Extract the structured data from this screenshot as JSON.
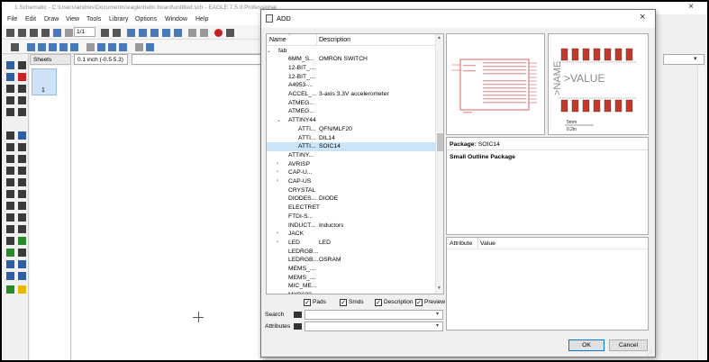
{
  "main_window": {
    "title": "1 Schematic - C:\\Users\\andres\\Documents\\eagle\\hello board\\untitled.sch - EAGLE 7.5.0 Professional",
    "menu": [
      "File",
      "Edit",
      "Draw",
      "View",
      "Tools",
      "Library",
      "Options",
      "Window",
      "Help"
    ],
    "zoom_select": "1/1",
    "sheets_label": "Sheets",
    "sheet_number": "1",
    "coordinate_readout": "0.1 inch (-0.5 5.3)",
    "close_icon": "×"
  },
  "dialog": {
    "title": "ADD",
    "close_icon": "×",
    "list": {
      "col_name": "Name",
      "col_description": "Description",
      "rows": [
        {
          "exp": "⌄",
          "name": "fab",
          "desc": "",
          "level": 0
        },
        {
          "exp": "",
          "name": "6MM_S...",
          "desc": "OMRON SWITCH",
          "level": 1
        },
        {
          "exp": "",
          "name": "12-BIT_...",
          "desc": "",
          "level": 1
        },
        {
          "exp": "",
          "name": "12-BIT_...",
          "desc": "",
          "level": 1
        },
        {
          "exp": "",
          "name": "A4953-...",
          "desc": "",
          "level": 1
        },
        {
          "exp": "",
          "name": "ACCEL_...",
          "desc": "3-axis 3.3V accelerometer",
          "level": 1
        },
        {
          "exp": "",
          "name": "ATMEG...",
          "desc": "",
          "level": 1
        },
        {
          "exp": "",
          "name": "ATMEG...",
          "desc": "",
          "level": 1
        },
        {
          "exp": "⌄",
          "name": "ATTINY44",
          "desc": "",
          "level": 1
        },
        {
          "exp": "",
          "name": "ATTI...",
          "desc": "QFN/MLF20",
          "level": 2
        },
        {
          "exp": "",
          "name": "ATTI...",
          "desc": "DIL14",
          "level": 2
        },
        {
          "exp": "",
          "name": "ATTI...",
          "desc": "SOIC14",
          "level": 2,
          "selected": true
        },
        {
          "exp": "",
          "name": "ATTINY...",
          "desc": "",
          "level": 1
        },
        {
          "exp": "›",
          "name": "AVRISP",
          "desc": "",
          "level": 1
        },
        {
          "exp": "›",
          "name": "CAP-U...",
          "desc": "",
          "level": 1
        },
        {
          "exp": "›",
          "name": "CAP-US",
          "desc": "",
          "level": 1
        },
        {
          "exp": "",
          "name": "CRYSTAL",
          "desc": "",
          "level": 1
        },
        {
          "exp": "",
          "name": "DIODES...",
          "desc": "DIODE",
          "level": 1
        },
        {
          "exp": "",
          "name": "ELECTRET",
          "desc": "",
          "level": 1
        },
        {
          "exp": "",
          "name": "FTDI-S...",
          "desc": "",
          "level": 1
        },
        {
          "exp": "",
          "name": "INDUCT...",
          "desc": "Inductors",
          "level": 1
        },
        {
          "exp": "›",
          "name": "JACK",
          "desc": "",
          "level": 1
        },
        {
          "exp": "›",
          "name": "LED",
          "desc": "LED",
          "level": 1
        },
        {
          "exp": "",
          "name": "LEDRGB...",
          "desc": "",
          "level": 1
        },
        {
          "exp": "",
          "name": "LEDRGB...",
          "desc": "OSRAM",
          "level": 1
        },
        {
          "exp": "",
          "name": "MEMS_...",
          "desc": "",
          "level": 1
        },
        {
          "exp": "",
          "name": "MEMS_...",
          "desc": "",
          "level": 1
        },
        {
          "exp": "",
          "name": "MIC_ME...",
          "desc": "",
          "level": 1
        },
        {
          "exp": "",
          "name": "MXD623...",
          "desc": "",
          "level": 1
        }
      ]
    },
    "checks": [
      {
        "label": "Pads",
        "checked": true
      },
      {
        "label": "Smds",
        "checked": true
      },
      {
        "label": "Description",
        "checked": true
      },
      {
        "label": "Preview",
        "checked": true
      }
    ],
    "search_label": "Search",
    "search_value": "",
    "attributes_label": "Attributes",
    "attributes_value": "",
    "package_preview": {
      "name_text": ">NAME",
      "value_text": ">VALUE",
      "scale_top": "5mm",
      "scale_bottom": "0.2in"
    },
    "package_label": "Package:",
    "package_value": "SOIC14",
    "package_description": "Small Outline Package",
    "attr_col_attribute": "Attribute",
    "attr_col_value": "Value",
    "ok_label": "OK",
    "cancel_label": "Cancel"
  },
  "colors": {
    "selection": "#cce4f7",
    "pad_red": "#c0392b",
    "symbol_red": "#d04040",
    "ok_border": "#0078d7"
  }
}
